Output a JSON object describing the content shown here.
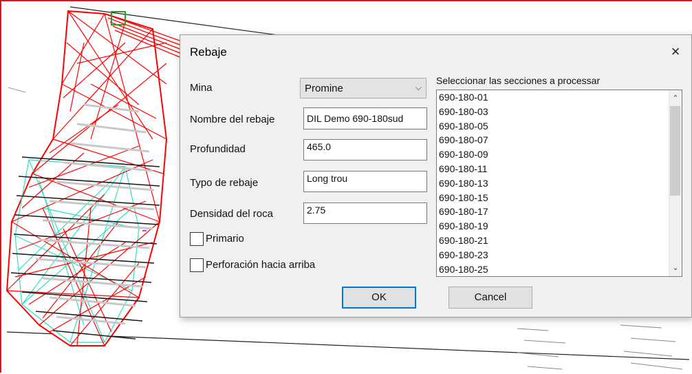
{
  "dialog": {
    "title": "Rebaje",
    "close_glyph": "×",
    "labels": {
      "mina": "Mina",
      "nombre": "Nombre del rebaje",
      "profundidad": "Profundidad",
      "typo": "Typo de rebaje",
      "densidad": "Densidad del roca"
    },
    "mina_select": {
      "value": "Promine",
      "arrow_glyph": "⌵"
    },
    "fields": {
      "nombre": "DIL Demo 690-180sud",
      "profundidad": "465.0",
      "typo": "Long trou",
      "densidad": "2.75"
    },
    "checkboxes": {
      "primario": {
        "label": "Primario",
        "checked": false
      },
      "perforacion": {
        "label": "Perforación hacia arriba",
        "checked": false
      }
    },
    "sections": {
      "title": "Seleccionar las secciones a processar",
      "items": [
        "690-180-01",
        "690-180-03",
        "690-180-05",
        "690-180-07",
        "690-180-09",
        "690-180-11",
        "690-180-13",
        "690-180-15",
        "690-180-17",
        "690-180-19",
        "690-180-21",
        "690-180-23",
        "690-180-25"
      ],
      "scroll_up_glyph": "⌃",
      "scroll_down_glyph": "⌄"
    },
    "buttons": {
      "ok": "OK",
      "cancel": "Cancel"
    }
  },
  "colors": {
    "wireframe": "#ff0000",
    "wireframe_secondary": "#2de0c0",
    "frame_border": "#e0141e",
    "selection_marker": "#2a9d2a",
    "ok_focus": "#0078d7"
  },
  "icons": [
    "close-icon",
    "chevron-down-icon",
    "scroll-up-icon",
    "scroll-down-icon"
  ]
}
